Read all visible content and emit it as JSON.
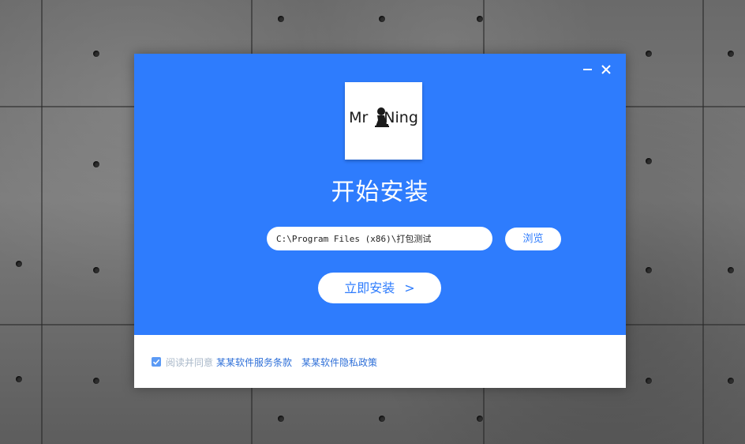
{
  "window": {
    "logo_text_left": "Mr",
    "logo_text_right": "Ning",
    "title": "开始安装",
    "minimize_icon": "minimize-icon",
    "close_icon": "close-icon"
  },
  "install_path": {
    "value": "C:\\Program Files (x86)\\打包测试"
  },
  "buttons": {
    "browse_label": "浏览",
    "install_label": "立即安装",
    "install_arrow": ">"
  },
  "agreement": {
    "checked": true,
    "prefix": "阅读并同意",
    "terms_link": "某某软件服务条款",
    "privacy_link": "某某软件隐私政策"
  },
  "colors": {
    "accent": "#2e7cfd",
    "link": "#2e6fd8",
    "muted_text": "#a9b8c9"
  }
}
